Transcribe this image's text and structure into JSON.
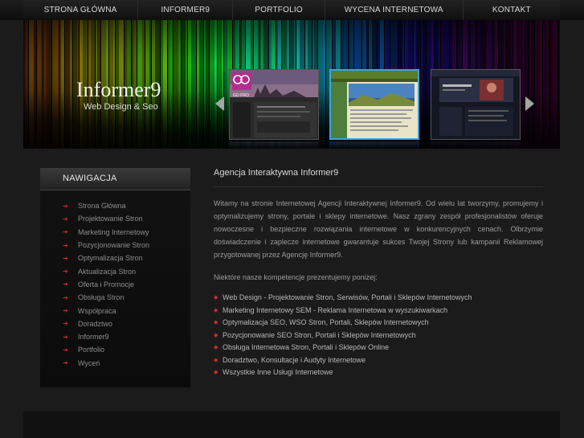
{
  "nav": {
    "items": [
      {
        "label": "STRONA GŁÓWNA"
      },
      {
        "label": "INFORMER9"
      },
      {
        "label": "PORTFOLIO"
      },
      {
        "label": "WYCENA INTERNETOWA"
      },
      {
        "label": "KONTAKT"
      }
    ]
  },
  "header": {
    "logo": "Informer9",
    "tagline": "Web Design & Seo",
    "thumb1_text": "GO PRO"
  },
  "sidebar": {
    "title": "NAWIGACJA",
    "items": [
      {
        "label": "Strona Główna"
      },
      {
        "label": "Projektowanie Stron"
      },
      {
        "label": "Marketing Internetowy"
      },
      {
        "label": "Pozycjonowanie Stron"
      },
      {
        "label": "Optymalizacja Stron"
      },
      {
        "label": "Aktualizacja Stron"
      },
      {
        "label": "Oferta i Promocje"
      },
      {
        "label": "Obsługa Stron"
      },
      {
        "label": "Współpraca"
      },
      {
        "label": "Doradztwo"
      },
      {
        "label": "Informer9"
      },
      {
        "label": "Portfolio"
      },
      {
        "label": "Wyceń"
      }
    ]
  },
  "main": {
    "title": "Agencja Interaktywna Informer9",
    "intro": "Witamy na stronie Internetowej Agencji Interaktywnej Informer9. Od wielu lat tworzymy, promujemy i optymalizujemy strony, portale i sklepy internetowe. Nasz zgrany zespół profesjonalistów oferuje nowoczesne i bezpieczne rozwiązania internetowe w konkurencyjnych cenach. Olbrzymie doświadczenie i zaplecze internetowe gwarantuje sukces Twojej Strony lub kampanii Reklamowej przygotowanej przez Agencję Informer9.",
    "lead": "Niektóre nasze kompetencje prezentujemy poniżej:",
    "competencies": [
      {
        "label": "Web Design - Projektowanie Stron, Serwisów, Portali i Sklepów Internetowych"
      },
      {
        "label": "Marketing Internetowy SEM - Reklama Internetowa w wyszukiwarkach"
      },
      {
        "label": "Optymalizacja SEO, WSO Stron, Portali, Sklepów Internetowych"
      },
      {
        "label": "Pozycjonowanie SEO Stron, Portali i Sklepów Internetowych"
      },
      {
        "label": "Obsługa Internetowa Stron, Portali i Sklepów Online"
      },
      {
        "label": "Doradztwo, Konsultacje i Audyty Internetowe"
      },
      {
        "label": "Wszystkie Inne Usługi Internetowe"
      }
    ]
  },
  "colors": {
    "accent_red": "#d42a2a",
    "active_thumb_border": "#3ea0e0",
    "background": "#1b1b1b"
  }
}
